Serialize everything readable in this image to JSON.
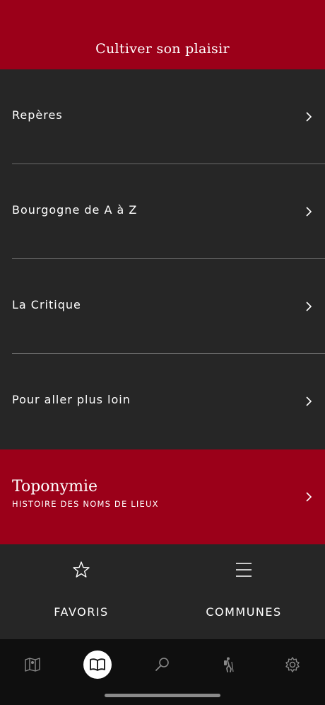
{
  "header": {
    "title": "Cultiver son plaisir"
  },
  "menu": {
    "items": [
      {
        "label": "Repères"
      },
      {
        "label": "Bourgogne de A à Z"
      },
      {
        "label": "La Critique"
      },
      {
        "label": "Pour aller plus loin"
      }
    ]
  },
  "toponymie": {
    "title": "Toponymie",
    "subtitle": "HISTOIRE DES NOMS DE LIEUX"
  },
  "quick_links": [
    {
      "label": "FAVORIS",
      "icon": "star-icon"
    },
    {
      "label": "COMMUNES",
      "icon": "menu-lines-icon"
    }
  ],
  "tabbar": {
    "tabs": [
      {
        "icon": "map-icon",
        "active": false
      },
      {
        "icon": "book-icon",
        "active": true
      },
      {
        "icon": "search-icon",
        "active": false
      },
      {
        "icon": "hiker-icon",
        "active": false
      },
      {
        "icon": "gear-icon",
        "active": false
      }
    ]
  },
  "colors": {
    "brand_red": "#9b0019",
    "background": "#262626",
    "tabbar": "#0f0f0f"
  }
}
